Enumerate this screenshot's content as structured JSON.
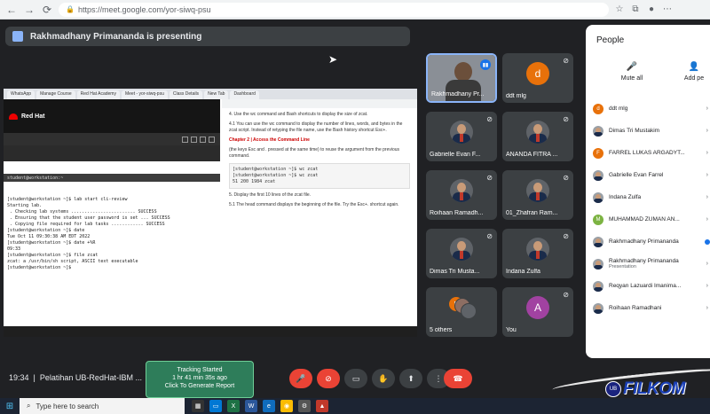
{
  "browser": {
    "url": "https://meet.google.com/yor-siwq-psu"
  },
  "meet": {
    "presenting_text": "Rakhmadhany Primananda is presenting",
    "meeting_time": "19:34",
    "meeting_title": "Pelatihan UB-RedHat-IBM ...",
    "tracking": {
      "line1": "Tracking Started",
      "line2": "1 hr 41 min 35s ago",
      "line3": "Click To Generate Report"
    }
  },
  "shared_screen": {
    "browser_tabs": [
      "WhatsApp",
      "Manage Course",
      "Red Hat Academy",
      "Meet - yor-siwq-psu",
      "Class Details",
      "New Tab",
      "Dashboard"
    ],
    "logo_text": "Red Hat",
    "terminal_title": "student@workstation:~",
    "terminal_lines": [
      "[student@workstation ~]$ lab start cli-review",
      "",
      "Starting lab.",
      "",
      " . Checking lab systems ........................ SUCCESS",
      " . Ensuring that the student user password is set ... SUCCESS",
      " . Copying file required for lab tasks ............ SUCCESS",
      "",
      "[student@workstation ~]$ date",
      "Tue Oct 11 09:30:38 AM EDT 2022",
      "[student@workstation ~]$ date +%R",
      "09:33",
      "[student@workstation ~]$ file zcat",
      "zcat: a /usr/bin/sh script, ASCII text executable",
      "[student@workstation ~]$ "
    ],
    "doc_step": "4. Use the wc command and Bash shortcuts to display the size of zcat.",
    "doc_substep": "4.1 You can use the wc command to display the number of lines, words, and bytes in the zcat script. Instead of retyping the file name, use the Bash history shortcut Esc+.",
    "doc_chapter": "Chapter 2 | Access the Command Line",
    "doc_para": "(the keys Esc and . pressed at the same time) to reuse the argument from the previous command.",
    "doc_code": [
      "[student@workstation ~]$ wc zcat",
      "[student@workstation ~]$ wc zcat",
      " 51  200 1984 zcat"
    ],
    "doc_step5": "5. Display the first 10 lines of the zcat file.",
    "doc_substep5": "5.1 The head command displays the beginning of the file. Try the Esc+. shortcut again."
  },
  "tiles": [
    {
      "name": "Rakhmadhany Pr...",
      "type": "video",
      "muted": false,
      "speaking": true
    },
    {
      "name": "ddt mlg",
      "type": "letter",
      "letter": "d",
      "color": "#e8710a",
      "muted": true
    },
    {
      "name": "Gabrielle Evan F...",
      "type": "photo",
      "muted": true
    },
    {
      "name": "ANANDA FITRA ...",
      "type": "photo",
      "muted": true
    },
    {
      "name": "Roihaan Ramadh...",
      "type": "photo",
      "muted": true
    },
    {
      "name": "01_Zhafran Ram...",
      "type": "photo",
      "muted": true
    },
    {
      "name": "Dimas Tri Musta...",
      "type": "photo",
      "muted": true
    },
    {
      "name": "Indana Zulfa",
      "type": "photo",
      "muted": true
    },
    {
      "name": "5 others",
      "type": "stack",
      "muted": false
    },
    {
      "name": "You",
      "type": "letter",
      "letter": "A",
      "color": "#a142a1",
      "muted": true
    }
  ],
  "others_stack": [
    {
      "letter": "F",
      "color": "#e8710a"
    },
    {
      "letter": "",
      "color": "#8d6e63"
    },
    {
      "letter": "",
      "color": "#5f6368"
    }
  ],
  "people": {
    "title": "People",
    "mute_all": "Mute all",
    "add_people": "Add pe",
    "list": [
      {
        "name": "ddt mlg",
        "avatar": "letter",
        "letter": "d",
        "color": "#e8710a"
      },
      {
        "name": "Dimas Tri Mustakim",
        "avatar": "photo"
      },
      {
        "name": "FARREL LUKAS ARGADYT...",
        "avatar": "letter",
        "letter": "F",
        "color": "#e8710a"
      },
      {
        "name": "Gabrielle Evan Farrel",
        "avatar": "photo"
      },
      {
        "name": "Indana Zulfa",
        "avatar": "photo"
      },
      {
        "name": "MUHAMMAD ZUMAN AN...",
        "avatar": "letter",
        "letter": "M",
        "color": "#7cb342"
      },
      {
        "name": "Rakhmadhany Primananda",
        "avatar": "photo"
      },
      {
        "name": "Rakhmadhany Primananda",
        "sub": "Presentation",
        "avatar": "photo"
      },
      {
        "name": "Reqyan Lazuardi Imanima...",
        "avatar": "photo"
      },
      {
        "name": "Roihaan Ramadhani",
        "avatar": "photo"
      }
    ]
  },
  "logo": {
    "ub": "UB",
    "text": "FILKOM",
    "sub": "FAKULTAS ILMU KOMPUTER"
  },
  "taskbar": {
    "search_placeholder": "Type here to search"
  }
}
